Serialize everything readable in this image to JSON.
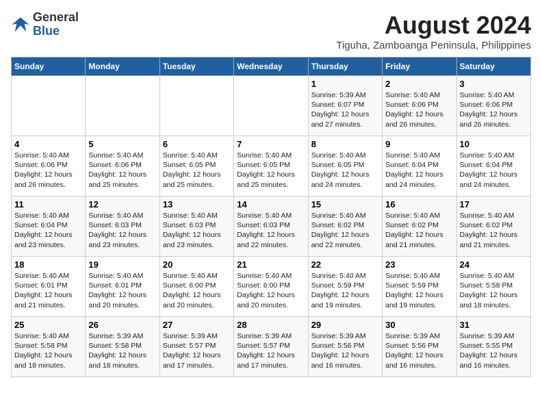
{
  "header": {
    "logo_general": "General",
    "logo_blue": "Blue",
    "main_title": "August 2024",
    "subtitle": "Tiguha, Zamboanga Peninsula, Philippines"
  },
  "weekdays": [
    "Sunday",
    "Monday",
    "Tuesday",
    "Wednesday",
    "Thursday",
    "Friday",
    "Saturday"
  ],
  "weeks": [
    [
      {
        "day": "",
        "info": ""
      },
      {
        "day": "",
        "info": ""
      },
      {
        "day": "",
        "info": ""
      },
      {
        "day": "",
        "info": ""
      },
      {
        "day": "1",
        "info": "Sunrise: 5:39 AM\nSunset: 6:07 PM\nDaylight: 12 hours\nand 27 minutes."
      },
      {
        "day": "2",
        "info": "Sunrise: 5:40 AM\nSunset: 6:06 PM\nDaylight: 12 hours\nand 26 minutes."
      },
      {
        "day": "3",
        "info": "Sunrise: 5:40 AM\nSunset: 6:06 PM\nDaylight: 12 hours\nand 26 minutes."
      }
    ],
    [
      {
        "day": "4",
        "info": "Sunrise: 5:40 AM\nSunset: 6:06 PM\nDaylight: 12 hours\nand 26 minutes."
      },
      {
        "day": "5",
        "info": "Sunrise: 5:40 AM\nSunset: 6:06 PM\nDaylight: 12 hours\nand 25 minutes."
      },
      {
        "day": "6",
        "info": "Sunrise: 5:40 AM\nSunset: 6:05 PM\nDaylight: 12 hours\nand 25 minutes."
      },
      {
        "day": "7",
        "info": "Sunrise: 5:40 AM\nSunset: 6:05 PM\nDaylight: 12 hours\nand 25 minutes."
      },
      {
        "day": "8",
        "info": "Sunrise: 5:40 AM\nSunset: 6:05 PM\nDaylight: 12 hours\nand 24 minutes."
      },
      {
        "day": "9",
        "info": "Sunrise: 5:40 AM\nSunset: 6:04 PM\nDaylight: 12 hours\nand 24 minutes."
      },
      {
        "day": "10",
        "info": "Sunrise: 5:40 AM\nSunset: 6:04 PM\nDaylight: 12 hours\nand 24 minutes."
      }
    ],
    [
      {
        "day": "11",
        "info": "Sunrise: 5:40 AM\nSunset: 6:04 PM\nDaylight: 12 hours\nand 23 minutes."
      },
      {
        "day": "12",
        "info": "Sunrise: 5:40 AM\nSunset: 6:03 PM\nDaylight: 12 hours\nand 23 minutes."
      },
      {
        "day": "13",
        "info": "Sunrise: 5:40 AM\nSunset: 6:03 PM\nDaylight: 12 hours\nand 23 minutes."
      },
      {
        "day": "14",
        "info": "Sunrise: 5:40 AM\nSunset: 6:03 PM\nDaylight: 12 hours\nand 22 minutes."
      },
      {
        "day": "15",
        "info": "Sunrise: 5:40 AM\nSunset: 6:02 PM\nDaylight: 12 hours\nand 22 minutes."
      },
      {
        "day": "16",
        "info": "Sunrise: 5:40 AM\nSunset: 6:02 PM\nDaylight: 12 hours\nand 21 minutes."
      },
      {
        "day": "17",
        "info": "Sunrise: 5:40 AM\nSunset: 6:02 PM\nDaylight: 12 hours\nand 21 minutes."
      }
    ],
    [
      {
        "day": "18",
        "info": "Sunrise: 5:40 AM\nSunset: 6:01 PM\nDaylight: 12 hours\nand 21 minutes."
      },
      {
        "day": "19",
        "info": "Sunrise: 5:40 AM\nSunset: 6:01 PM\nDaylight: 12 hours\nand 20 minutes."
      },
      {
        "day": "20",
        "info": "Sunrise: 5:40 AM\nSunset: 6:00 PM\nDaylight: 12 hours\nand 20 minutes."
      },
      {
        "day": "21",
        "info": "Sunrise: 5:40 AM\nSunset: 6:00 PM\nDaylight: 12 hours\nand 20 minutes."
      },
      {
        "day": "22",
        "info": "Sunrise: 5:40 AM\nSunset: 5:59 PM\nDaylight: 12 hours\nand 19 minutes."
      },
      {
        "day": "23",
        "info": "Sunrise: 5:40 AM\nSunset: 5:59 PM\nDaylight: 12 hours\nand 19 minutes."
      },
      {
        "day": "24",
        "info": "Sunrise: 5:40 AM\nSunset: 5:58 PM\nDaylight: 12 hours\nand 18 minutes."
      }
    ],
    [
      {
        "day": "25",
        "info": "Sunrise: 5:40 AM\nSunset: 5:58 PM\nDaylight: 12 hours\nand 18 minutes."
      },
      {
        "day": "26",
        "info": "Sunrise: 5:39 AM\nSunset: 5:58 PM\nDaylight: 12 hours\nand 18 minutes."
      },
      {
        "day": "27",
        "info": "Sunrise: 5:39 AM\nSunset: 5:57 PM\nDaylight: 12 hours\nand 17 minutes."
      },
      {
        "day": "28",
        "info": "Sunrise: 5:39 AM\nSunset: 5:57 PM\nDaylight: 12 hours\nand 17 minutes."
      },
      {
        "day": "29",
        "info": "Sunrise: 5:39 AM\nSunset: 5:56 PM\nDaylight: 12 hours\nand 16 minutes."
      },
      {
        "day": "30",
        "info": "Sunrise: 5:39 AM\nSunset: 5:56 PM\nDaylight: 12 hours\nand 16 minutes."
      },
      {
        "day": "31",
        "info": "Sunrise: 5:39 AM\nSunset: 5:55 PM\nDaylight: 12 hours\nand 16 minutes."
      }
    ]
  ]
}
